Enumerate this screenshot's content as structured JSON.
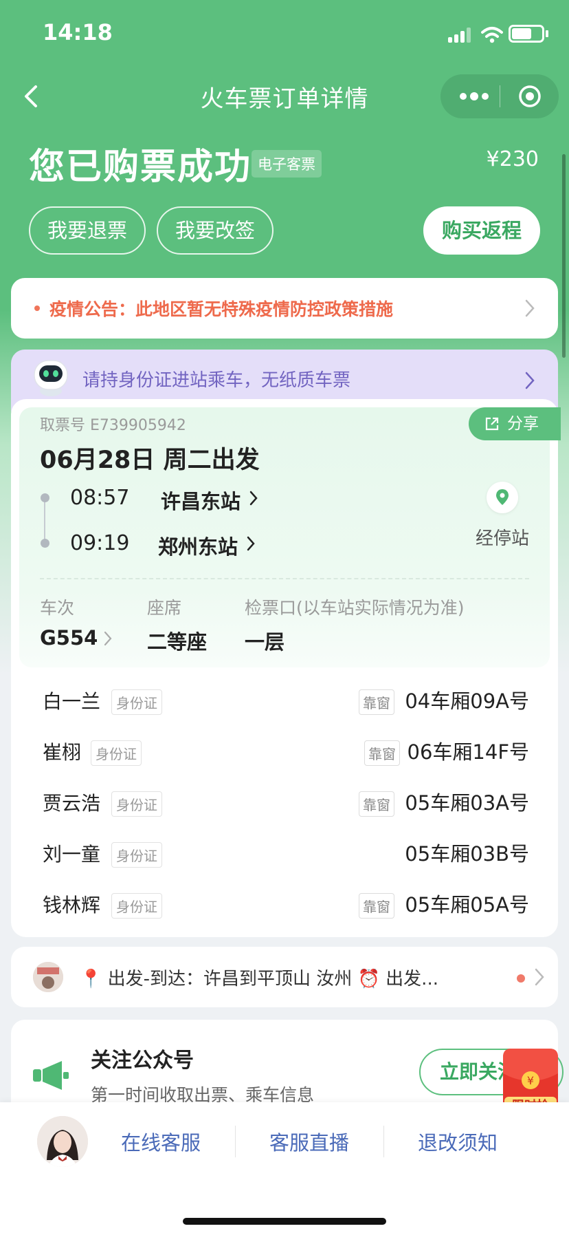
{
  "status_bar": {
    "time": "14:18"
  },
  "nav": {
    "title": "火车票订单详情"
  },
  "header": {
    "headline": "您已购票成功",
    "badge": "电子客票",
    "price": "¥230",
    "buttons": {
      "refund": "我要退票",
      "change": "我要改签",
      "return_trip": "购买返程"
    }
  },
  "notice": {
    "text": "疫情公告：此地区暂无特殊疫情防控政策措施"
  },
  "id_banner": {
    "text": "请持身份证进站乘车，无纸质车票"
  },
  "ticket": {
    "share_label": "分享",
    "pickup_number": "取票号 E739905942",
    "departure_date": "06月28日 周二出发",
    "departure": {
      "time": "08:57",
      "station": "许昌东站"
    },
    "arrival": {
      "time": "09:19",
      "station": "郑州东站"
    },
    "stops_label": "经停站",
    "train_label": "车次",
    "train_number": "G554",
    "seat_label": "座席",
    "seat_class": "二等座",
    "gate_label": "检票口(以车站实际情况为准)",
    "gate": "一层"
  },
  "passengers": [
    {
      "name": "白一兰",
      "doc": "身份证",
      "tag": "靠窗",
      "seat": "04车厢09A号"
    },
    {
      "name": "崔栩",
      "doc": "身份证",
      "tag": "靠窗",
      "seat": "06车厢14F号"
    },
    {
      "name": "贾云浩",
      "doc": "身份证",
      "tag": "靠窗",
      "seat": "05车厢03A号"
    },
    {
      "name": "刘一童",
      "doc": "身份证",
      "tag": "",
      "seat": "05车厢03B号"
    },
    {
      "name": "钱林辉",
      "doc": "身份证",
      "tag": "靠窗",
      "seat": "05车厢05A号"
    }
  ],
  "ad": {
    "text": "📍 出发-到达：许昌到平顶山 汝州 ⏰ 出发..."
  },
  "follow": {
    "title": "关注公众号",
    "subtitle": "第一时间收取出票、乘车信息",
    "button": "立即关注",
    "promo": "限时抢"
  },
  "bottom_bar": {
    "service": "在线客服",
    "live": "客服直播",
    "policy": "退改须知"
  },
  "colors": {
    "brand": "#5cbf7e",
    "notice": "#ee6a4c",
    "link": "#4a6ab8",
    "banner": "#e4def9"
  }
}
